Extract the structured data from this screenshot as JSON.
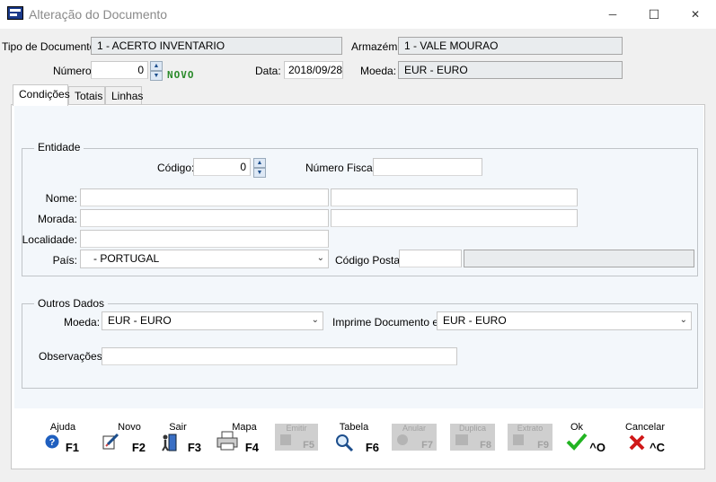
{
  "window": {
    "title": "Alteração do Documento",
    "minimize_glyph": "─",
    "maximize_glyph": "☐",
    "close_glyph": "✕"
  },
  "header": {
    "tipo_documento_label": "Tipo de Documento:",
    "tipo_documento_value": "1 - ACERTO INVENTARIO",
    "armazem_label": "Armazém:",
    "armazem_value": "1 - VALE MOURAO",
    "numero_label": "Número:",
    "numero_value": "0",
    "novo_badge": "NOVO",
    "data_label": "Data:",
    "data_value": "2018/09/28",
    "moeda_label": "Moeda:",
    "moeda_value": "EUR - EURO"
  },
  "tabs": [
    {
      "label": "Condições",
      "active": true
    },
    {
      "label": "Totais",
      "active": false
    },
    {
      "label": "Linhas",
      "active": false
    }
  ],
  "entidade": {
    "legend": "Entidade",
    "codigo_label": "Código:",
    "codigo_value": "0",
    "numero_fiscal_label": "Número Fiscal:",
    "numero_fiscal_value": "",
    "nome_label": "Nome:",
    "morada_label": "Morada:",
    "localidade_label": "Localidade:",
    "pais_label": "País:",
    "pais_value": "- PORTUGAL",
    "codigo_postal_label": "Código Postal:"
  },
  "outros": {
    "legend": "Outros Dados",
    "moeda_label": "Moeda:",
    "moeda_value": "EUR - EURO",
    "imprime_label": "Imprime Documento em:",
    "imprime_value": "EUR - EURO",
    "observacoes_label": "Observações:",
    "observacoes_value": ""
  },
  "toolbar": [
    {
      "label": "Ajuda",
      "key": "F1",
      "icon": "help-icon",
      "enabled": true
    },
    {
      "label": "Novo",
      "key": "F2",
      "icon": "new-document-icon",
      "enabled": true
    },
    {
      "label": "Sair",
      "key": "F3",
      "icon": "exit-icon",
      "enabled": true
    },
    {
      "label": "Mapa",
      "key": "F4",
      "icon": "printer-icon",
      "enabled": true
    },
    {
      "label": "Emitir",
      "key": "F5",
      "icon": "emit-icon",
      "enabled": false
    },
    {
      "label": "Tabela",
      "key": "F6",
      "icon": "table-search-icon",
      "enabled": true
    },
    {
      "label": "Anular",
      "key": "F7",
      "icon": "cancel-doc-icon",
      "enabled": false
    },
    {
      "label": "Duplica",
      "key": "F8",
      "icon": "duplicate-icon",
      "enabled": false
    },
    {
      "label": "Extrato",
      "key": "F9",
      "icon": "statement-icon",
      "enabled": false
    },
    {
      "label": "Ok",
      "key": "^O",
      "icon": "checkmark-icon",
      "enabled": true
    },
    {
      "label": "Cancelar",
      "key": "^C",
      "icon": "x-cancel-icon",
      "enabled": true
    }
  ],
  "colors": {
    "novo": "#2a8a2a",
    "ok_check": "#22b422",
    "cancel_x": "#d01818",
    "help_blue": "#1f5fbf"
  }
}
